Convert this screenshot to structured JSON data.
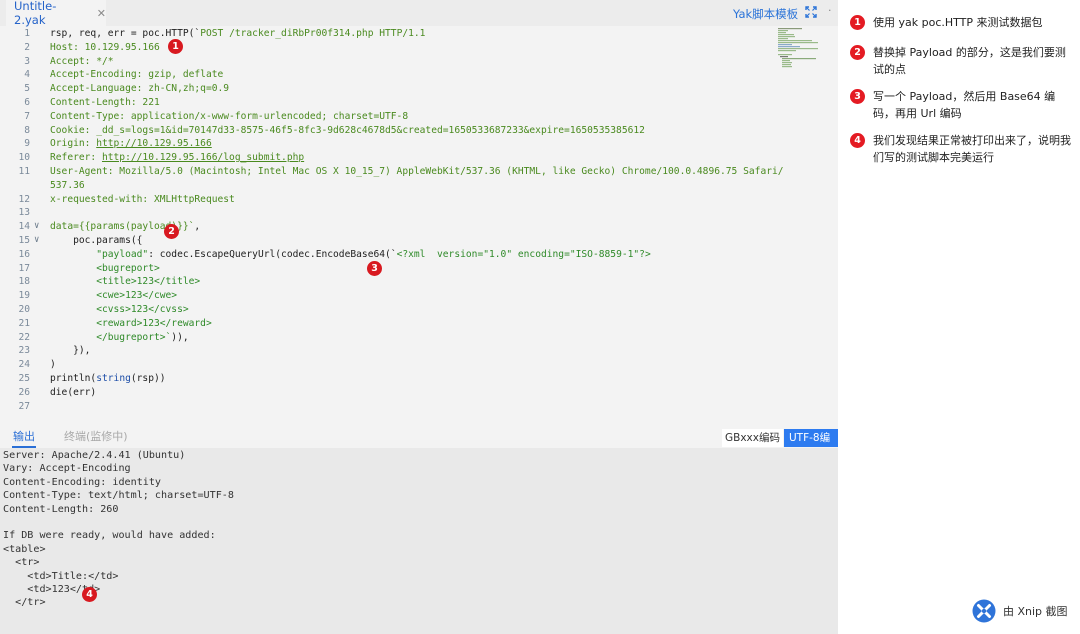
{
  "tab": {
    "file_name": "Untitle-2.yak",
    "close_glyph": "✕"
  },
  "toolbar": {
    "template_button": "Yak脚本模板",
    "expand_icon": "expand-icon",
    "more_glyph": "·"
  },
  "editor": {
    "lines": [
      {
        "n": "1",
        "fold": "",
        "segs": [
          {
            "t": "rsp, req, err = poc.HTTP(`",
            "c": "plain"
          },
          {
            "t": "POST /tracker_diRbPr00f314.php HTTP/1.1",
            "c": "green"
          }
        ]
      },
      {
        "n": "2",
        "fold": "",
        "segs": [
          {
            "t": "Host: 10.129.95.166",
            "c": "green"
          }
        ]
      },
      {
        "n": "3",
        "fold": "",
        "segs": [
          {
            "t": "Accept: */*",
            "c": "green"
          }
        ]
      },
      {
        "n": "4",
        "fold": "",
        "segs": [
          {
            "t": "Accept-Encoding: gzip, deflate",
            "c": "green"
          }
        ]
      },
      {
        "n": "5",
        "fold": "",
        "segs": [
          {
            "t": "Accept-Language: zh-CN,zh;q=0.9",
            "c": "green"
          }
        ]
      },
      {
        "n": "6",
        "fold": "",
        "segs": [
          {
            "t": "Content-Length: 221",
            "c": "green"
          }
        ]
      },
      {
        "n": "7",
        "fold": "",
        "segs": [
          {
            "t": "Content-Type: application/x-www-form-urlencoded; charset=UTF-8",
            "c": "green"
          }
        ]
      },
      {
        "n": "8",
        "fold": "",
        "segs": [
          {
            "t": "Cookie: _dd_s=logs=1&id=70147d33-8575-46f5-8fc3-9d628c4678d5&created=1650533687233&expire=1650535385612",
            "c": "green"
          }
        ]
      },
      {
        "n": "9",
        "fold": "",
        "segs": [
          {
            "t": "Origin: ",
            "c": "green"
          },
          {
            "t": "http://10.129.95.166",
            "c": "link"
          }
        ]
      },
      {
        "n": "10",
        "fold": "",
        "segs": [
          {
            "t": "Referer: ",
            "c": "green"
          },
          {
            "t": "http://10.129.95.166/log_submit.php",
            "c": "link"
          }
        ]
      },
      {
        "n": "11",
        "fold": "",
        "segs": [
          {
            "t": "User-Agent: Mozilla/5.0 (Macintosh; Intel Mac OS X 10_15_7) AppleWebKit/537.36 (KHTML, like Gecko) Chrome/100.0.4896.75 Safari/",
            "c": "green"
          }
        ]
      },
      {
        "n": "",
        "fold": "",
        "segs": [
          {
            "t": "537.36",
            "c": "green"
          }
        ]
      },
      {
        "n": "12",
        "fold": "",
        "segs": [
          {
            "t": "x-requested-with: XMLHttpRequest",
            "c": "green"
          }
        ]
      },
      {
        "n": "13",
        "fold": "",
        "segs": []
      },
      {
        "n": "14",
        "fold": "∨",
        "segs": [
          {
            "t": "data={{params(payload)}}`",
            "c": "green"
          },
          {
            "t": ",",
            "c": "plain"
          }
        ]
      },
      {
        "n": "15",
        "fold": "∨",
        "segs": [
          {
            "t": "    poc.params({",
            "c": "plain"
          }
        ]
      },
      {
        "n": "16",
        "fold": "",
        "segs": [
          {
            "t": "        ",
            "c": "plain"
          },
          {
            "t": "\"payload\"",
            "c": "str"
          },
          {
            "t": ": codec.EscapeQueryUrl(codec.EncodeBase64(`",
            "c": "plain"
          },
          {
            "t": "<?xml  version=\"1.0\" encoding=\"ISO-8859-1\"?>",
            "c": "str"
          }
        ]
      },
      {
        "n": "17",
        "fold": "",
        "segs": [
          {
            "t": "        <bugreport>",
            "c": "str"
          }
        ]
      },
      {
        "n": "18",
        "fold": "",
        "segs": [
          {
            "t": "        <title>123</title>",
            "c": "str"
          }
        ]
      },
      {
        "n": "19",
        "fold": "",
        "segs": [
          {
            "t": "        <cwe>123</cwe>",
            "c": "str"
          }
        ]
      },
      {
        "n": "20",
        "fold": "",
        "segs": [
          {
            "t": "        <cvss>123</cvss>",
            "c": "str"
          }
        ]
      },
      {
        "n": "21",
        "fold": "",
        "segs": [
          {
            "t": "        <reward>123</reward>",
            "c": "str"
          }
        ]
      },
      {
        "n": "22",
        "fold": "",
        "segs": [
          {
            "t": "        </bugreport>`",
            "c": "str"
          },
          {
            "t": ")),",
            "c": "plain"
          }
        ]
      },
      {
        "n": "23",
        "fold": "",
        "segs": [
          {
            "t": "    }),",
            "c": "plain"
          }
        ]
      },
      {
        "n": "24",
        "fold": "",
        "segs": [
          {
            "t": ")",
            "c": "plain"
          }
        ]
      },
      {
        "n": "25",
        "fold": "",
        "segs": [
          {
            "t": "println(",
            "c": "plain"
          },
          {
            "t": "string",
            "c": "blu"
          },
          {
            "t": "(rsp))",
            "c": "plain"
          }
        ]
      },
      {
        "n": "26",
        "fold": "",
        "segs": [
          {
            "t": "die(err)",
            "c": "plain"
          }
        ]
      },
      {
        "n": "27",
        "fold": "",
        "segs": []
      }
    ]
  },
  "output": {
    "tab_output": "输出",
    "tab_terminal": "终端(监修中)",
    "encoding_gb": "GBxxx编码",
    "encoding_utf": "UTF-8编",
    "lines": [
      "Server: Apache/2.4.41 (Ubuntu)",
      "Vary: Accept-Encoding",
      "Content-Encoding: identity",
      "Content-Type: text/html; charset=UTF-8",
      "Content-Length: 260",
      "",
      "If DB were ready, would have added:",
      "<table>",
      "  <tr>",
      "    <td>Title:</td>",
      "    <td>123</td>",
      "  </tr>"
    ]
  },
  "badges": [
    "1",
    "2",
    "3",
    "4"
  ],
  "notes": [
    {
      "num": "1",
      "text": "使用 yak poc.HTTP 来测试数据包"
    },
    {
      "num": "2",
      "text": "替换掉 Payload 的部分，这是我们要测试的点"
    },
    {
      "num": "3",
      "text": "写一个 Payload，然后用 Base64 编码，再用 Url 编码"
    },
    {
      "num": "4",
      "text": "我们发现结果正常被打印出来了，说明我们写的测试脚本完美运行"
    }
  ],
  "watermark": {
    "text": "由 Xnip 截图",
    "icon": "xnip-logo-icon"
  }
}
